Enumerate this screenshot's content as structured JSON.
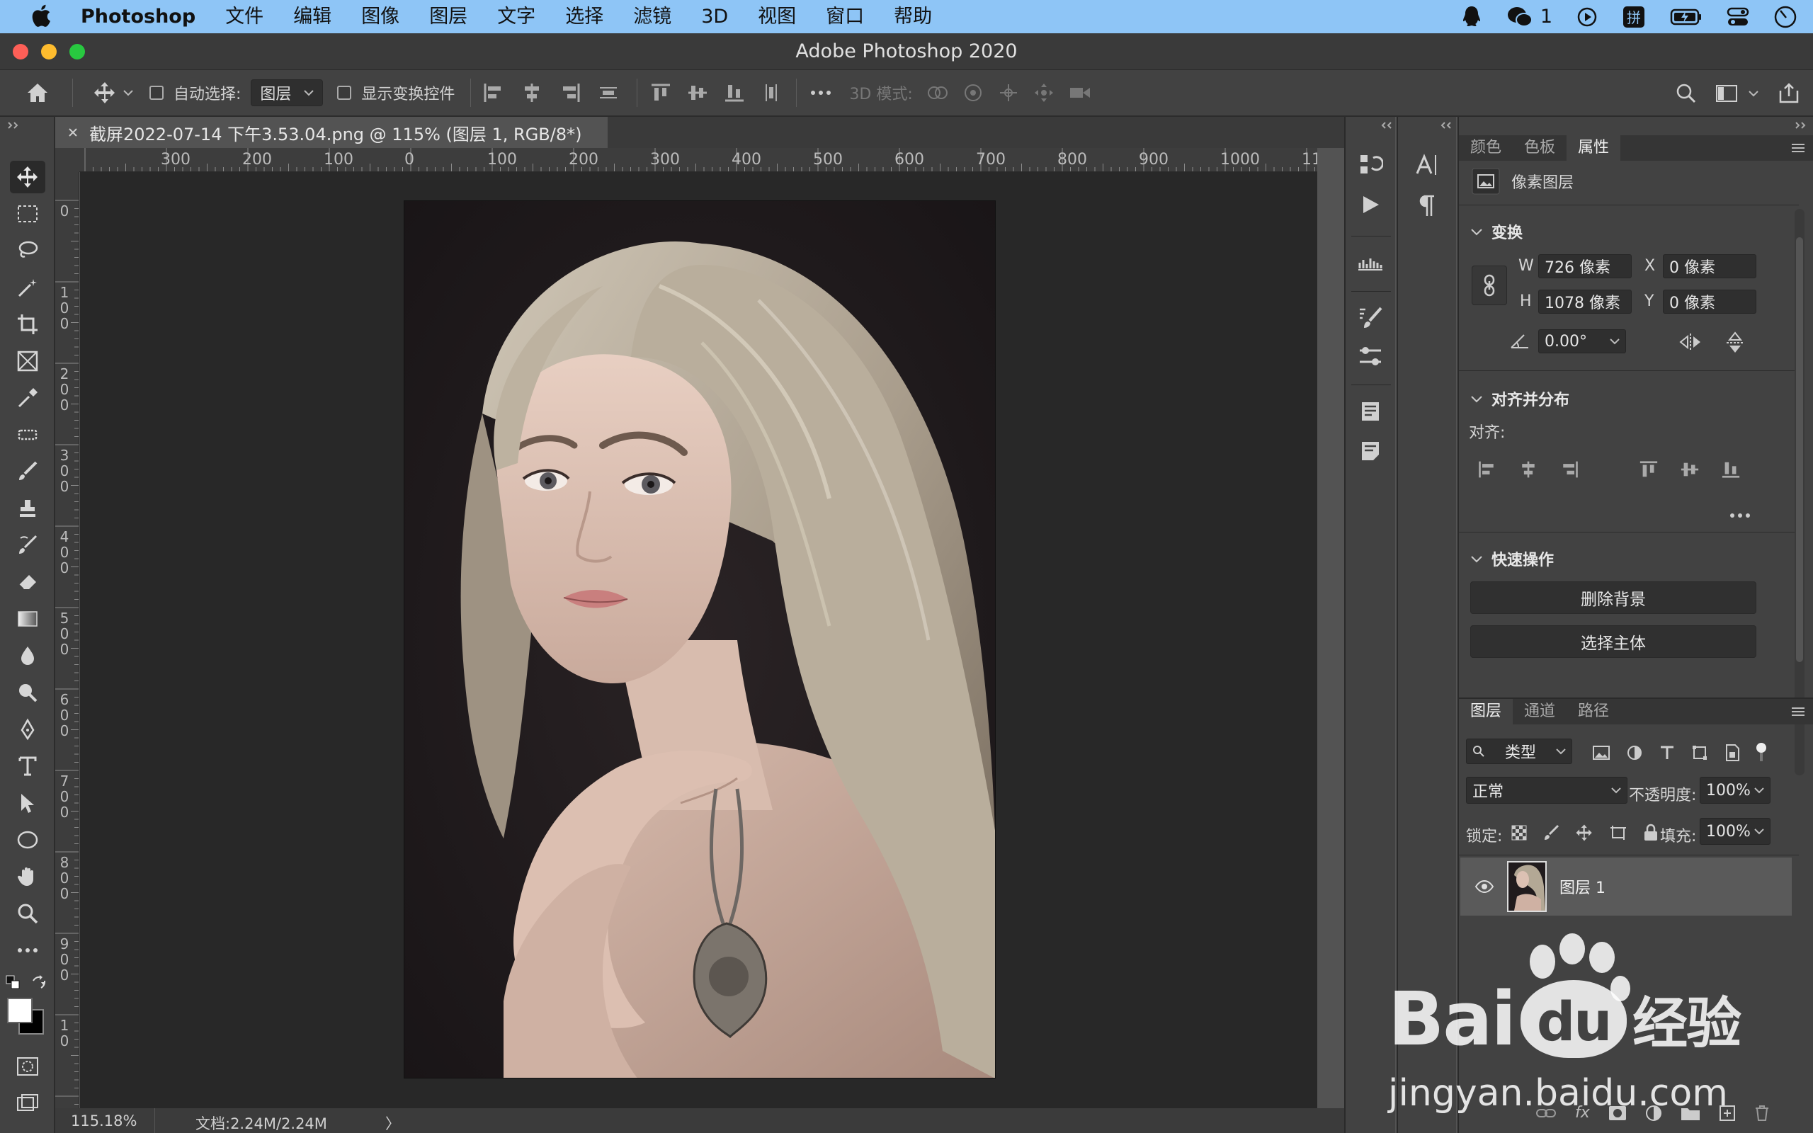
{
  "menubar": {
    "app": "Photoshop",
    "items": [
      "文件",
      "编辑",
      "图像",
      "图层",
      "文字",
      "选择",
      "滤镜",
      "3D",
      "视图",
      "窗口",
      "帮助"
    ],
    "wechat_count": "1"
  },
  "window": {
    "title": "Adobe Photoshop 2020"
  },
  "options": {
    "auto_select_label": "自动选择:",
    "auto_select_value": "图层",
    "show_transform_label": "显示变换控件",
    "mode_3d_label": "3D 模式:"
  },
  "document": {
    "tab_title": "截屏2022-07-14 下午3.53.04.png @ 115% (图层 1, RGB/8*)",
    "ruler_top": [
      "300",
      "200",
      "100",
      "0",
      "100",
      "200",
      "300",
      "400",
      "500",
      "600",
      "700",
      "800",
      "900",
      "1000",
      "11"
    ],
    "ruler_left": [
      "0",
      "1\n0\n0",
      "2\n0\n0",
      "3\n0\n0",
      "4\n0\n0",
      "5\n0\n0",
      "6\n0\n0",
      "7\n0\n0",
      "8\n0\n0",
      "9\n0\n0",
      "1\n0"
    ]
  },
  "status": {
    "zoom": "115.18%",
    "doc_size": "文档:2.24M/2.24M",
    "arrow": "〉"
  },
  "properties": {
    "tabs": [
      "颜色",
      "色板",
      "属性"
    ],
    "active_tab": "属性",
    "layer_type": "像素图层",
    "transform": {
      "heading": "变换",
      "w_label": "W",
      "w_value": "726 像素",
      "h_label": "H",
      "h_value": "1078 像素",
      "x_label": "X",
      "x_value": "0 像素",
      "y_label": "Y",
      "y_value": "0 像素",
      "angle_value": "0.00°"
    },
    "align": {
      "heading": "对齐并分布",
      "label": "对齐:"
    },
    "quick_actions": {
      "heading": "快速操作",
      "remove_bg": "删除背景",
      "select_subject": "选择主体"
    }
  },
  "layers": {
    "tabs": [
      "图层",
      "通道",
      "路径"
    ],
    "active_tab": "图层",
    "filter_label": "类型",
    "blend_mode": "正常",
    "opacity_label": "不透明度:",
    "opacity_value": "100%",
    "lock_label": "锁定:",
    "fill_label": "填充:",
    "fill_value": "100%",
    "items": [
      {
        "name": "图层 1",
        "visible": true
      }
    ]
  },
  "watermark": {
    "brand": "Bai",
    "brand2": "du",
    "cn": "经验",
    "url": "jingyan.baidu.com"
  },
  "colors": {
    "menubar": "#8ec5f6",
    "panel": "#424242",
    "canvas": "#282828",
    "workspace": "#535353"
  }
}
